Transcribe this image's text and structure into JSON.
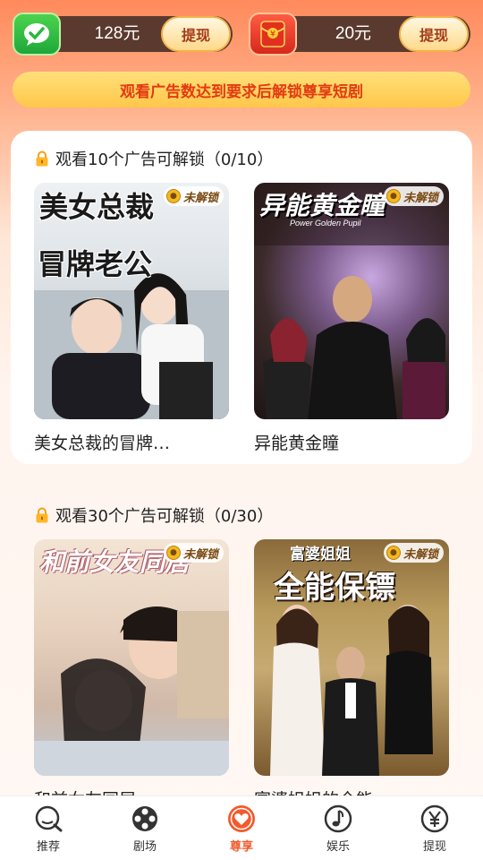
{
  "wallet": {
    "cash": {
      "amount": "128元",
      "button": "提现"
    },
    "redpacket": {
      "amount": "20元",
      "button": "提现"
    }
  },
  "banner": "观看广告数达到要求后解锁尊享短剧",
  "sections": [
    {
      "title": "观看10个广告可解锁（0/10）",
      "cards": [
        {
          "badge": "未解锁",
          "name": "美女总裁的冒牌…",
          "poster_text": "美女总裁的冒牌老公"
        },
        {
          "badge": "未解锁",
          "name": "异能黄金瞳",
          "poster_text": "异能黄金瞳",
          "poster_sub": "Power Golden Pupil"
        }
      ]
    },
    {
      "title": "观看30个广告可解锁（0/30）",
      "cards": [
        {
          "badge": "未解锁",
          "name": "和前女友同居",
          "poster_text": "和前女友同居"
        },
        {
          "badge": "未解锁",
          "name": "富婆姐姐的全能…",
          "poster_text": "全能保镖",
          "poster_top": "富婆姐姐"
        }
      ]
    }
  ],
  "tabs": [
    {
      "label": "推荐",
      "icon": "search-icon"
    },
    {
      "label": "剧场",
      "icon": "film-reel-icon"
    },
    {
      "label": "尊享",
      "icon": "heart-badge-icon",
      "active": true
    },
    {
      "label": "娱乐",
      "icon": "music-note-icon"
    },
    {
      "label": "提现",
      "icon": "yen-coin-icon"
    }
  ],
  "colors": {
    "accent": "#f25b2c",
    "banner_text": "#e23b12",
    "pill_bg": "#5a3a2e"
  }
}
